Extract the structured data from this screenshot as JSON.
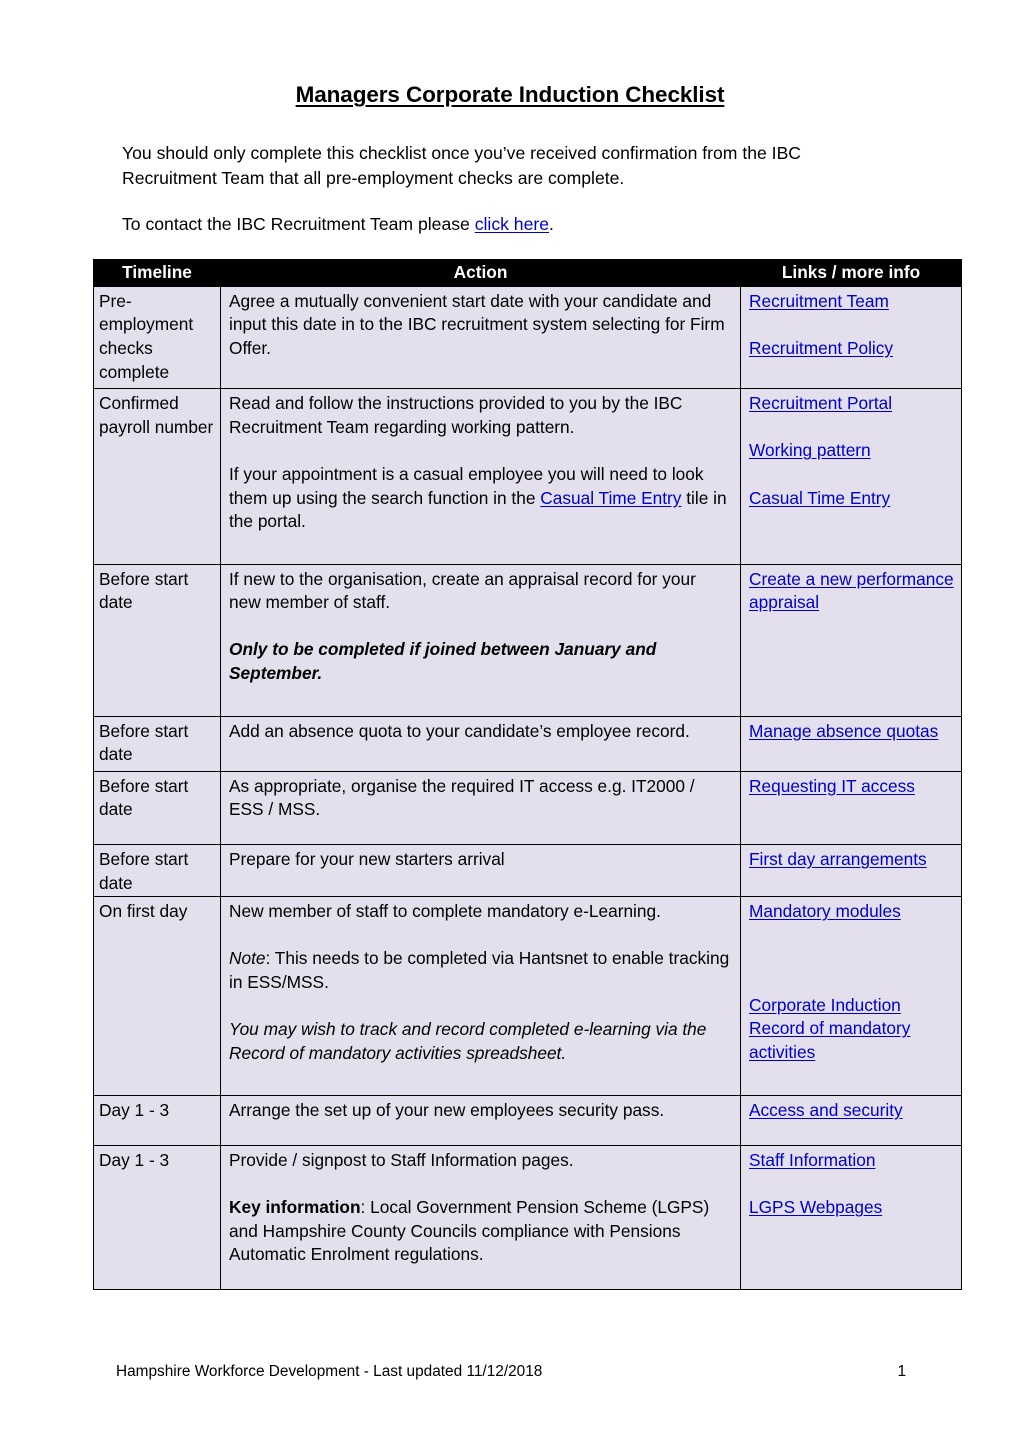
{
  "document": {
    "title": "Managers Corporate Induction Checklist",
    "intro_line_1": "You should only complete this checklist once you’ve received confirmation from the IBC Recruitment Team that all pre-employment checks are complete.",
    "intro_line_2_prefix": "To contact the IBC Recruitment Team please ",
    "intro_line_2_link": "click here",
    "intro_line_2_suffix": "."
  },
  "table": {
    "headers": {
      "timeline": "Timeline",
      "action": "Action",
      "links": "Links / more info"
    },
    "rows": [
      {
        "timeline": "Pre-employment checks complete",
        "action_p1": "Agree a mutually convenient start date with your candidate and input this date in to the IBC recruitment system selecting for Firm Offer.",
        "links": [
          "Recruitment Team",
          "Recruitment Policy"
        ]
      },
      {
        "timeline": "Confirmed payroll number",
        "action_p1": "Read and follow the instructions provided to you by the IBC Recruitment Team regarding working pattern.",
        "action_p2_a": "If your appointment is a casual employee you will need to look them up using the search function in the ",
        "action_p2_link": "Casual Time Entry",
        "action_p2_b": " tile in the portal.",
        "links": [
          "Recruitment Portal",
          "Working pattern",
          "Casual Time Entry"
        ]
      },
      {
        "timeline": "Before start date",
        "action_p1": "If new to the organisation, create an appraisal record for your new member of staff.",
        "action_p2": "Only to be completed if joined between January and September.",
        "links": [
          "Create a new performance appraisal"
        ]
      },
      {
        "timeline": "Before start date",
        "action_p1": "Add an absence quota to your candidate’s employee record.",
        "links": [
          "Manage absence quotas"
        ]
      },
      {
        "timeline": "Before start date",
        "action_p1": "As appropriate, organise the required IT access e.g. IT2000 / ESS / MSS.",
        "links": [
          "Requesting IT access"
        ]
      },
      {
        "timeline": "Before start date",
        "action_p1": "Prepare for your new starters arrival",
        "links": [
          "First day arrangements"
        ]
      },
      {
        "timeline": "On first day",
        "action_p1": "New member of staff to complete mandatory e-Learning.",
        "action_p2_note": "Note",
        "action_p2_rest": ": This needs to be completed via Hantsnet to enable tracking in ESS/MSS.",
        "action_p3": "You may wish to track and record completed e-learning via the Record of mandatory activities spreadsheet.",
        "links": [
          "Mandatory modules",
          "Corporate Induction Record of mandatory activities"
        ]
      },
      {
        "timeline": "Day 1 - 3",
        "action_p1": "Arrange the set up of your new employees security pass.",
        "links": [
          "Access and security"
        ]
      },
      {
        "timeline": "Day 1 - 3",
        "action_p1": "Provide / signpost to Staff Information pages.",
        "action_p2_bold": "Key information",
        "action_p2_rest": ": Local Government Pension Scheme (LGPS) and Hampshire County Councils compliance with Pensions Automatic Enrolment regulations.",
        "links": [
          "Staff Information",
          "LGPS Webpages"
        ]
      }
    ]
  },
  "footer": {
    "text": "Hampshire Workforce Development - Last updated 11/12/2018",
    "page_number": "1"
  },
  "colors": {
    "link": "#0000CC",
    "cell_background": "#E3DFEC",
    "header_background": "#000000",
    "header_text": "#FFFFFF"
  }
}
